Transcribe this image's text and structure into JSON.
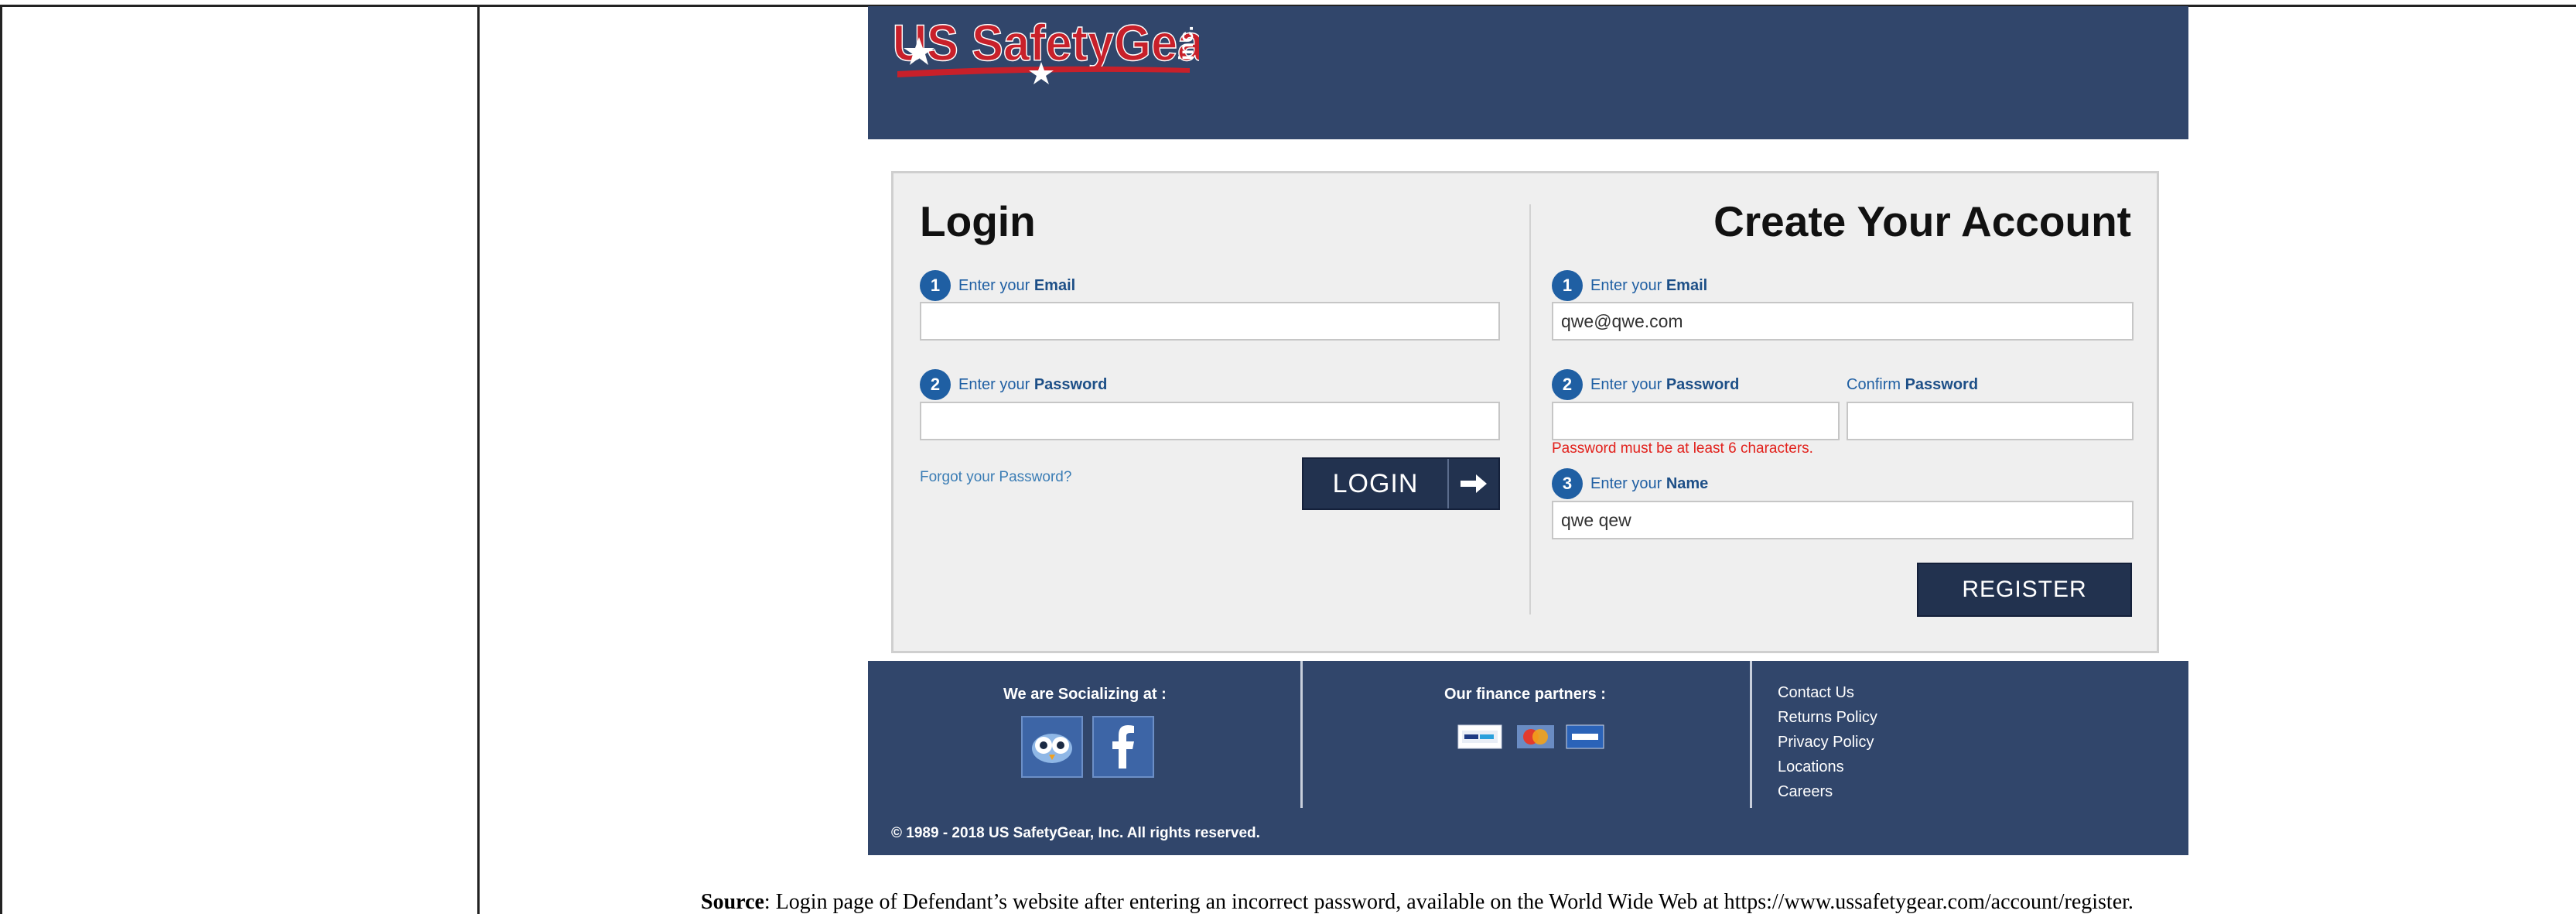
{
  "brand": {
    "logo_text": "US SafetyGear",
    "logo_suffix": "inc."
  },
  "login": {
    "heading": "Login",
    "email_step": "1",
    "email_prefix": "Enter your ",
    "email_word": "Email",
    "email_value": "",
    "password_step": "2",
    "password_prefix": "Enter your ",
    "password_word": "Password",
    "password_value": "",
    "forgot_label": "Forgot your Password?",
    "button_label": "LOGIN"
  },
  "register": {
    "heading": "Create Your Account",
    "email_step": "1",
    "email_prefix": "Enter your ",
    "email_word": "Email",
    "email_value": "qwe@qwe.com",
    "password_step": "2",
    "password_prefix": "Enter your ",
    "password_word": "Password",
    "password_value": "",
    "confirm_prefix": "Confirm ",
    "confirm_word": "Password",
    "confirm_value": "",
    "error": "Password must be at least 6 characters.",
    "name_step": "3",
    "name_prefix": "Enter your ",
    "name_word": "Name",
    "name_value": "qwe qew",
    "button_label": "REGISTER"
  },
  "footer": {
    "social_title": "We are Socializing at :",
    "social_icons": [
      "owl-icon",
      "facebook-icon"
    ],
    "finance_title": "Our finance partners :",
    "finance_icons": [
      "paypal-icon",
      "mastercard-icon",
      "visa-icon"
    ],
    "links": [
      "Contact Us",
      "Returns Policy",
      "Privacy Policy",
      "Locations",
      "Careers"
    ],
    "copyright": "© 1989 - 2018 US SafetyGear, Inc. All rights reserved."
  },
  "caption": {
    "label": "Source",
    "text": ": Login page of Defendant’s website after entering an incorrect password, available on the World Wide Web at https://www.ussafetygear.com/account/register."
  },
  "colors": {
    "header_bg": "#31466b",
    "accent_blue": "#1f5fa3",
    "error_red": "#e2211c",
    "button_bg": "#22324f"
  }
}
